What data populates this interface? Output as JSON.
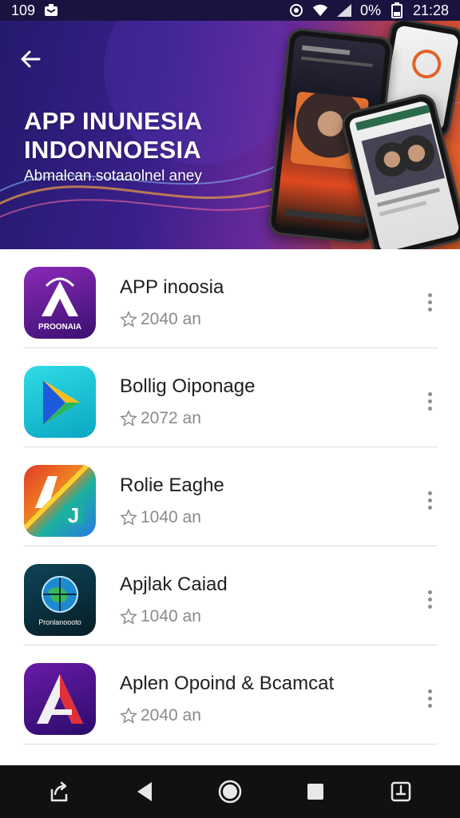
{
  "status_bar": {
    "left_text": "109",
    "battery_percent": "0%",
    "time": "21:28",
    "icons": [
      "notification-icon",
      "eye-icon",
      "wifi-icon",
      "signal-icon",
      "battery-icon"
    ]
  },
  "header": {
    "back_icon": "back-arrow-icon",
    "title_line1": "APP INUNESIA",
    "title_line2": "INDONNOESIA",
    "subtitle": "Abmalcan.sotaaolnel aney",
    "colors": {
      "gradient_start": "#241a6e",
      "gradient_mid": "#6a2a9a",
      "gradient_end": "#e0632a"
    }
  },
  "apps": [
    {
      "name": "APP inoosia",
      "rating": "2040 an",
      "icon": "purple-a-logo",
      "icon_text": "PROONAIA",
      "colors": [
        "#7a1fa8",
        "#3a1070"
      ]
    },
    {
      "name": "Bollig Oiponage",
      "rating": "2072 an",
      "icon": "play-triangle-logo",
      "icon_text": "",
      "colors": [
        "#1ec8d8",
        "#0aa6c2"
      ]
    },
    {
      "name": "Rolie Eaghe",
      "rating": "1040 an",
      "icon": "colorful-a-logo",
      "icon_text": "",
      "colors": [
        "#e03a2a",
        "#1bb0a0"
      ]
    },
    {
      "name": "Apjlak Caiad",
      "rating": "1040 an",
      "icon": "globe-logo",
      "icon_text": "Pronlanoooto",
      "colors": [
        "#0c3a4a",
        "#061e28"
      ]
    },
    {
      "name": "Aplen Opoind & Bcamcat",
      "rating": "2040 an",
      "icon": "red-a-logo",
      "icon_text": "",
      "colors": [
        "#5a1a9a",
        "#2a0c6a"
      ]
    }
  ],
  "nav_bar": {
    "icons": [
      "share-icon",
      "back-triangle-icon",
      "home-circle-icon",
      "recents-square-icon",
      "download-icon"
    ]
  }
}
